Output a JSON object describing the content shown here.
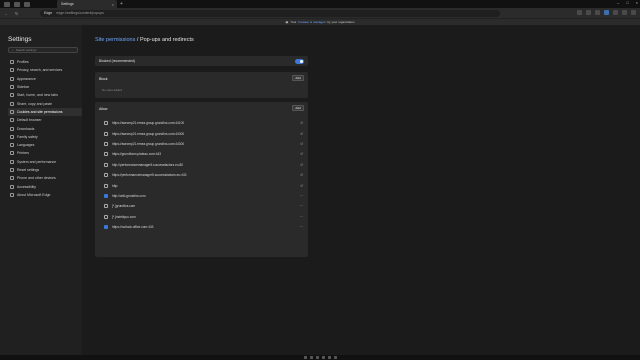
{
  "browser": {
    "tab_title": "Settings",
    "url_site": "Edge",
    "url_path": "edge://settings/content/popups",
    "banner_text": "Your",
    "banner_link": "browser is managed",
    "banner_suffix": "by your organization"
  },
  "sidebar": {
    "title": "Settings",
    "search_placeholder": "Search settings",
    "items": [
      {
        "label": "Profiles"
      },
      {
        "label": "Privacy, search, and services"
      },
      {
        "label": "Appearance"
      },
      {
        "label": "Sidebar"
      },
      {
        "label": "Start, home, and new tabs"
      },
      {
        "label": "Share, copy and paste"
      },
      {
        "label": "Cookies and site permissions"
      },
      {
        "label": "Default browser"
      },
      {
        "label": "Downloads"
      },
      {
        "label": "Family safety"
      },
      {
        "label": "Languages"
      },
      {
        "label": "Printers"
      },
      {
        "label": "System and performance"
      },
      {
        "label": "Reset settings"
      },
      {
        "label": "Phone and other devices"
      },
      {
        "label": "Accessibility"
      },
      {
        "label": "About Microsoft Edge"
      }
    ]
  },
  "main": {
    "breadcrumb_link": "Site permissions",
    "breadcrumb_current": "/ Pop-ups and redirects",
    "blocked_label": "Blocked (recommended)",
    "block": {
      "title": "Block",
      "add_label": "Add",
      "empty_text": "No sites added"
    },
    "allow": {
      "title": "Allow",
      "add_label": "Add",
      "sites": [
        {
          "url": "https://asecmp21.emea.group.grundfos.com:44100",
          "action": "↺",
          "fav": "globe"
        },
        {
          "url": "https://asecmp21.emea.group.grundfos.com:44300",
          "action": "↺",
          "fav": "globe"
        },
        {
          "url": "https://asecmp21.emea.group.grundfos.com:44300",
          "action": "↺",
          "fav": "globe"
        },
        {
          "url": "https://grundfosm.plateau.com:443",
          "action": "↺",
          "fav": "globe"
        },
        {
          "url": "http://performancemanager5.successfactors.eu:80",
          "action": "↺",
          "fav": "globe"
        },
        {
          "url": "https://performancemanager5.successfactors.eu:443",
          "action": "↺",
          "fav": "globe"
        },
        {
          "url": "http:",
          "action": "↺",
          "fav": "globe"
        },
        {
          "url": "http://wiki.grundfos.com",
          "action": "⋯",
          "fav": "blue"
        },
        {
          "url": "[*.]grundfos.com",
          "action": "⋯",
          "fav": "globe"
        },
        {
          "url": "[*.]mdeliquo.com",
          "action": "⋯",
          "fav": "globe"
        },
        {
          "url": "https://outlook.office.com:443",
          "action": "⋯",
          "fav": "blue"
        }
      ]
    }
  }
}
